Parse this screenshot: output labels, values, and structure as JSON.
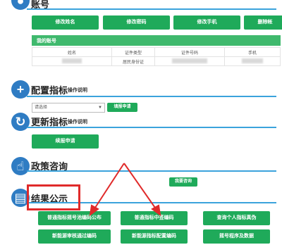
{
  "account": {
    "title": "账号",
    "buttons": [
      "修改姓名",
      "修改密码",
      "修改手机",
      "删除帐"
    ],
    "subheader": "我的账号",
    "table_headers": [
      "姓名",
      "证件类型",
      "证件号码",
      "手机"
    ],
    "row": {
      "id_type": "居民身份证"
    }
  },
  "config": {
    "title": "配置指标",
    "help": "操作说明",
    "select_value": "请选择",
    "fill_button": "填报申请"
  },
  "update": {
    "title": "更新指标",
    "help": "操作说明",
    "renew_button": "续报申请"
  },
  "policy": {
    "title": "政策咨询",
    "consult_button": "我要咨询"
  },
  "results": {
    "title": "结果公示",
    "buttons": [
      "普通指标摇号池编码公布",
      "普通指标中签编码",
      "查询个人指标真伪",
      "新能源审核通过编码",
      "新能源指标配置编码",
      "摇号程序及数据"
    ]
  },
  "colors": {
    "green": "#1faa5a",
    "blue": "#2f7cc3",
    "line": "#3ba3dc",
    "annotation": "#e02a2a"
  }
}
